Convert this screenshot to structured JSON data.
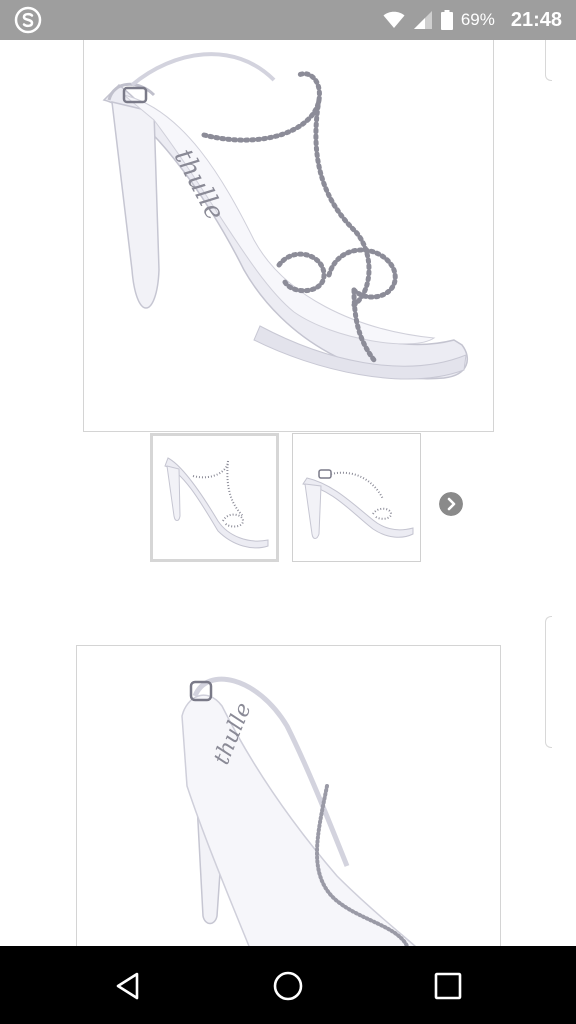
{
  "status_bar": {
    "app_icon": "s-circle-icon",
    "battery_percent": "69%",
    "time": "21:48",
    "icons": [
      "wifi-icon",
      "cellular-signal-icon",
      "battery-icon"
    ],
    "background": "#9e9e9e"
  },
  "product_gallery": {
    "main_image": "silver-rhinestone-strappy-sandal",
    "thumbnails": [
      {
        "image": "sandal-side-view",
        "selected": true
      },
      {
        "image": "sandal-alt-view",
        "selected": false
      }
    ],
    "next_icon": "chevron-right-circle-icon"
  },
  "second_product": {
    "image": "silver-slingback-sandal"
  },
  "nav_bar": {
    "back_icon": "back-triangle-icon",
    "home_icon": "home-circle-icon",
    "recents_icon": "recents-square-icon"
  }
}
